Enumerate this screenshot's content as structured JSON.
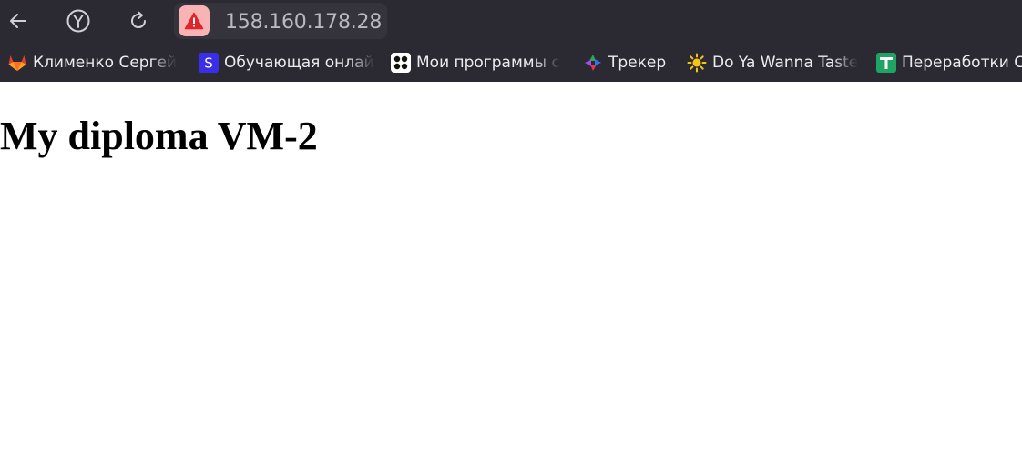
{
  "browser": {
    "address_bar": {
      "url": "158.160.178.28",
      "security": "not-secure"
    },
    "nav": {
      "back_icon": "arrow-left-icon",
      "home_icon": "yandex-icon",
      "reload_icon": "reload-icon"
    }
  },
  "bookmarks": [
    {
      "label": "Клименко Сергей",
      "icon": "gitlab-icon"
    },
    {
      "label": "Обучающая онлай",
      "icon": "s-icon"
    },
    {
      "label": "Мои программы с",
      "icon": "dots-icon"
    },
    {
      "label": "Трекер",
      "icon": "tracker-icon"
    },
    {
      "label": "Do Ya Wanna Taste",
      "icon": "sun-icon"
    },
    {
      "label": "Переработки С",
      "icon": "sheet-icon"
    }
  ],
  "page": {
    "heading": "My diploma VM-2"
  },
  "colors": {
    "toolbar_bg": "#2b2a33",
    "warning_badge": "#f8b4b4",
    "warning_icon": "#e0242b"
  }
}
